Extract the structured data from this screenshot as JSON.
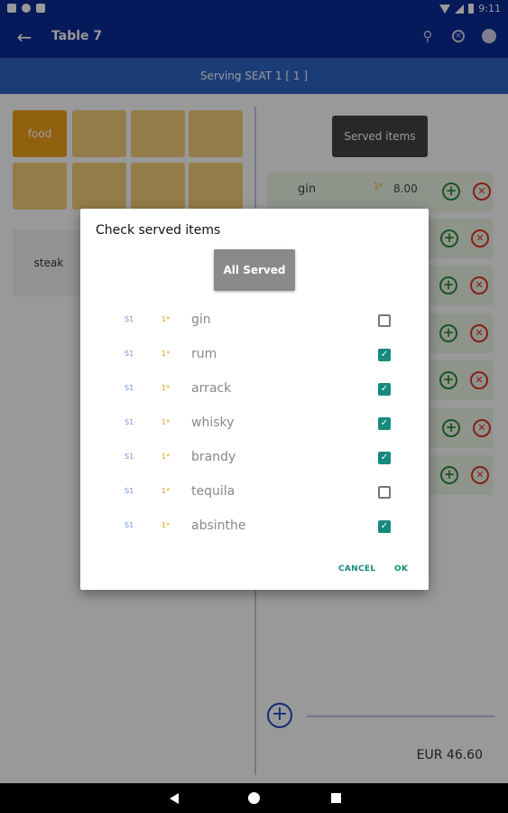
{
  "status_bar": {
    "time": "9:11"
  },
  "app_bar": {
    "title": "Table 7"
  },
  "serving_bar": {
    "text": "Serving SEAT 1 [ 1 ]"
  },
  "categories": [
    "food",
    "",
    "",
    "",
    "",
    "",
    "",
    ""
  ],
  "dish": {
    "name": "steak"
  },
  "served_items_button": "Served items",
  "order_rows": [
    {
      "name": "gin",
      "qty": "1*",
      "price": "8.00"
    },
    {
      "name": "",
      "qty": "",
      "price": ""
    },
    {
      "name": "",
      "qty": "",
      "price": ""
    },
    {
      "name": "",
      "qty": "",
      "price": ""
    },
    {
      "name": "",
      "qty": "",
      "price": ""
    },
    {
      "name": "",
      "qty": "",
      "price": ""
    },
    {
      "name": "",
      "qty": "",
      "price": ""
    }
  ],
  "total": "EUR 46.60",
  "dialog": {
    "title": "Check served items",
    "all_served_label": "All Served",
    "items": [
      {
        "seat": "S1",
        "qty": "1*",
        "name": "gin",
        "checked": false
      },
      {
        "seat": "S1",
        "qty": "1*",
        "name": "rum",
        "checked": true
      },
      {
        "seat": "S1",
        "qty": "1*",
        "name": "arrack",
        "checked": true
      },
      {
        "seat": "S1",
        "qty": "1*",
        "name": "whisky",
        "checked": true
      },
      {
        "seat": "S1",
        "qty": "1*",
        "name": "brandy",
        "checked": true
      },
      {
        "seat": "S1",
        "qty": "1*",
        "name": "tequila",
        "checked": false
      },
      {
        "seat": "S1",
        "qty": "1*",
        "name": "absinthe",
        "checked": true
      }
    ],
    "cancel_label": "CANCEL",
    "ok_label": "OK"
  },
  "colors": {
    "primary": "#0a2a96",
    "accent": "#178a7d",
    "category_active": "#f1a21a"
  }
}
